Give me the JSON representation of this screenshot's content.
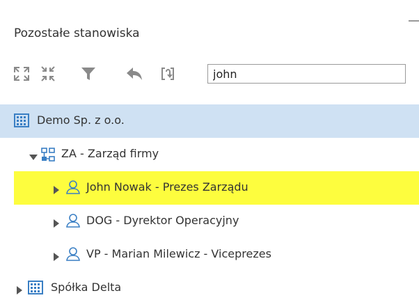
{
  "panel": {
    "title": "Pozostałe stanowiska"
  },
  "toolbar": {
    "buttons": [
      {
        "icon": "expand-all-icon"
      },
      {
        "icon": "collapse-all-icon"
      },
      {
        "icon": "filter-icon"
      },
      {
        "icon": "undo-icon"
      },
      {
        "icon": "refresh-icon"
      }
    ],
    "search_value": "john"
  },
  "tree": {
    "items": [
      {
        "label": "Demo Sp. z o.o.",
        "icon": "company-icon",
        "state": "selected"
      },
      {
        "label": "ZA - Zarząd firmy",
        "icon": "org-unit-icon",
        "expanded": true
      },
      {
        "label": "John Nowak - Prezes Zarządu",
        "icon": "person-icon",
        "state": "highlighted"
      },
      {
        "label": "DOG - Dyrektor Operacyjny",
        "icon": "person-icon"
      },
      {
        "label": "VP - Marian Milewicz - Viceprezes",
        "icon": "person-icon"
      },
      {
        "label": "Spółka Delta",
        "icon": "company-icon"
      }
    ]
  },
  "colors": {
    "selected_bg": "#cfe1f3",
    "highlight_bg": "#fdfd3e",
    "icon_blue": "#3a7fc4",
    "icon_gray": "#8a8a8a"
  }
}
